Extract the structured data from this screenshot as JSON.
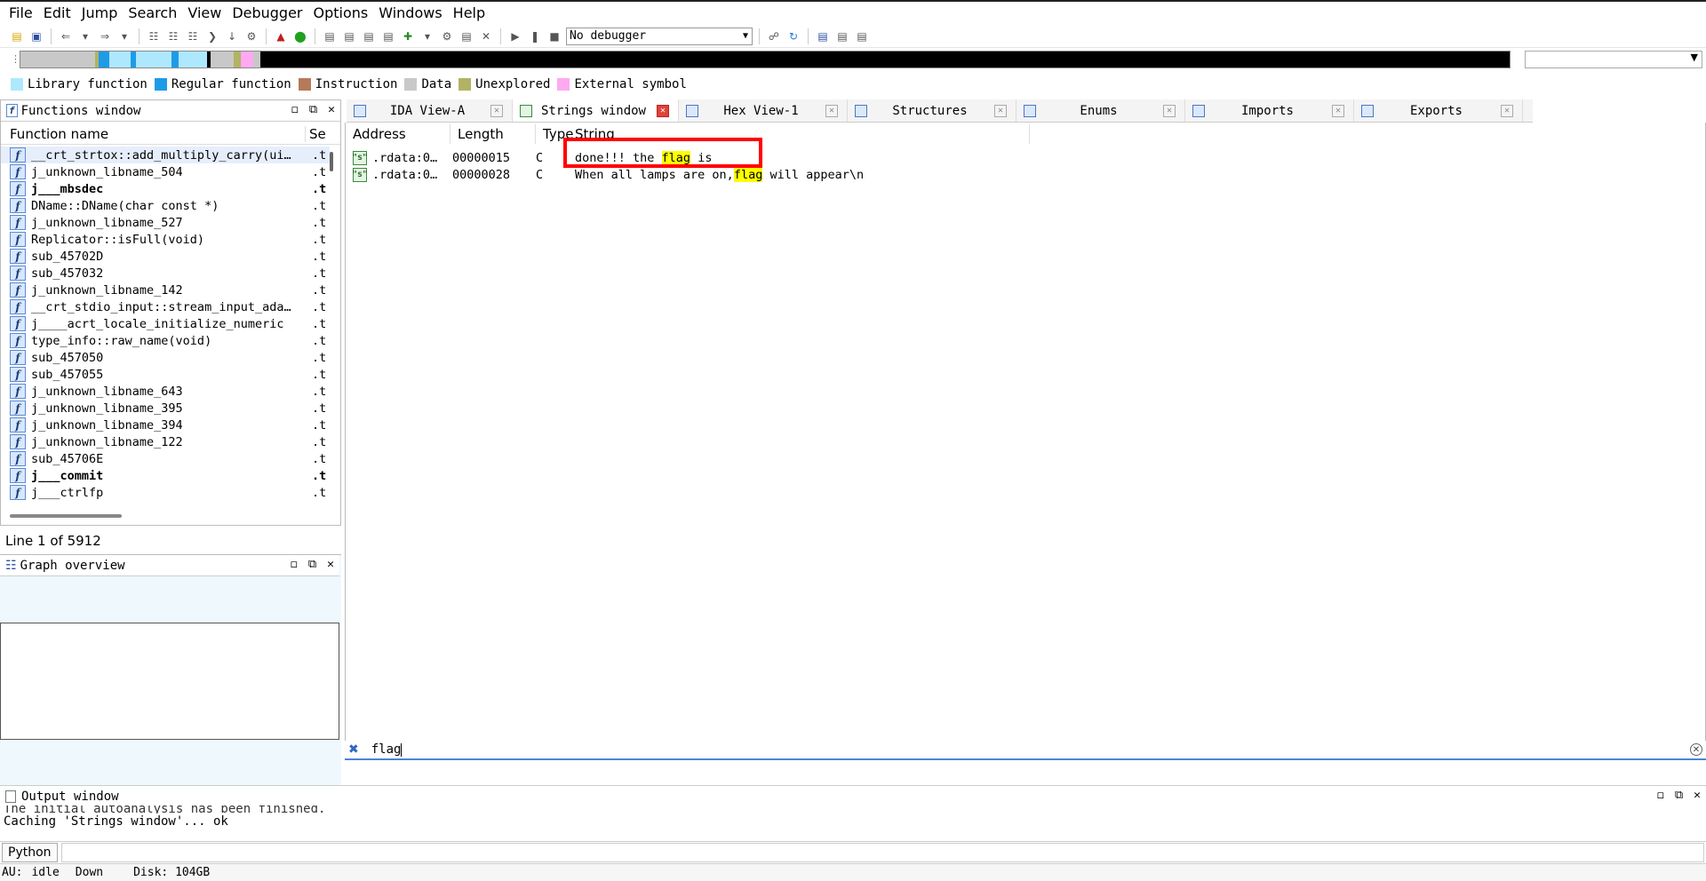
{
  "menu": [
    "File",
    "Edit",
    "Jump",
    "Search",
    "View",
    "Debugger",
    "Options",
    "Windows",
    "Help"
  ],
  "toolbar": {
    "debugger_select": "No debugger"
  },
  "legend": [
    {
      "label": "Library function",
      "color": "#aee8ff"
    },
    {
      "label": "Regular function",
      "color": "#1e9be6"
    },
    {
      "label": "Instruction",
      "color": "#b57a5a"
    },
    {
      "label": "Data",
      "color": "#c8c8c8"
    },
    {
      "label": "Unexplored",
      "color": "#b2b266"
    },
    {
      "label": "External symbol",
      "color": "#ffa9f0"
    }
  ],
  "functions_window": {
    "title": "Functions window",
    "col_name": "Function name",
    "col_seg": "Se",
    "rows": [
      {
        "name": "__crt_strtox::add_multiply_carry(ui…",
        "seg": ".t",
        "bold": false
      },
      {
        "name": "j_unknown_libname_504",
        "seg": ".t",
        "bold": false
      },
      {
        "name": "j___mbsdec",
        "seg": ".t",
        "bold": true
      },
      {
        "name": "DName::DName(char const *)",
        "seg": ".t",
        "bold": false
      },
      {
        "name": "j_unknown_libname_527",
        "seg": ".t",
        "bold": false
      },
      {
        "name": "Replicator::isFull(void)",
        "seg": ".t",
        "bold": false
      },
      {
        "name": "sub_45702D",
        "seg": ".t",
        "bold": false
      },
      {
        "name": "sub_457032",
        "seg": ".t",
        "bold": false
      },
      {
        "name": "j_unknown_libname_142",
        "seg": ".t",
        "bold": false
      },
      {
        "name": "__crt_stdio_input::stream_input_ada…",
        "seg": ".t",
        "bold": false
      },
      {
        "name": "j____acrt_locale_initialize_numeric",
        "seg": ".t",
        "bold": false
      },
      {
        "name": "type_info::raw_name(void)",
        "seg": ".t",
        "bold": false
      },
      {
        "name": "sub_457050",
        "seg": ".t",
        "bold": false
      },
      {
        "name": "sub_457055",
        "seg": ".t",
        "bold": false
      },
      {
        "name": "j_unknown_libname_643",
        "seg": ".t",
        "bold": false
      },
      {
        "name": "j_unknown_libname_395",
        "seg": ".t",
        "bold": false
      },
      {
        "name": "j_unknown_libname_394",
        "seg": ".t",
        "bold": false
      },
      {
        "name": "j_unknown_libname_122",
        "seg": ".t",
        "bold": false
      },
      {
        "name": "sub_45706E",
        "seg": ".t",
        "bold": false
      },
      {
        "name": "j___commit",
        "seg": ".t",
        "bold": true
      },
      {
        "name": "j___ctrlfp",
        "seg": ".t",
        "bold": false
      }
    ]
  },
  "status_line": "Line 1 of 5912",
  "graph_overview": {
    "title": "Graph overview"
  },
  "tabs": [
    {
      "label": "IDA View-A",
      "active": false
    },
    {
      "label": "Strings window",
      "active": true
    },
    {
      "label": "Hex View-1",
      "active": false
    },
    {
      "label": "Structures",
      "active": false
    },
    {
      "label": "Enums",
      "active": false
    },
    {
      "label": "Imports",
      "active": false
    },
    {
      "label": "Exports",
      "active": false
    }
  ],
  "strings_window": {
    "columns": [
      "Address",
      "Length",
      "Type",
      "String"
    ],
    "rows": [
      {
        "address": ".rdata:0…",
        "length": "00000015",
        "type": "C",
        "pre": "done!!! the ",
        "match": "flag",
        "post": " is"
      },
      {
        "address": ".rdata:0…",
        "length": "00000028",
        "type": "C",
        "pre": "When all lamps are on,",
        "match": "flag",
        "post": " will appear\\n"
      }
    ]
  },
  "filter": {
    "text": "flag"
  },
  "output_window": {
    "title": "Output window",
    "lines": [
      "The initial autoanalysis has been finished.",
      "Caching 'Strings window'... ok"
    ]
  },
  "python_button": "Python",
  "statusbar": {
    "au": "AU:",
    "state": "idle",
    "dir": "Down",
    "disk": "Disk: 104GB"
  }
}
